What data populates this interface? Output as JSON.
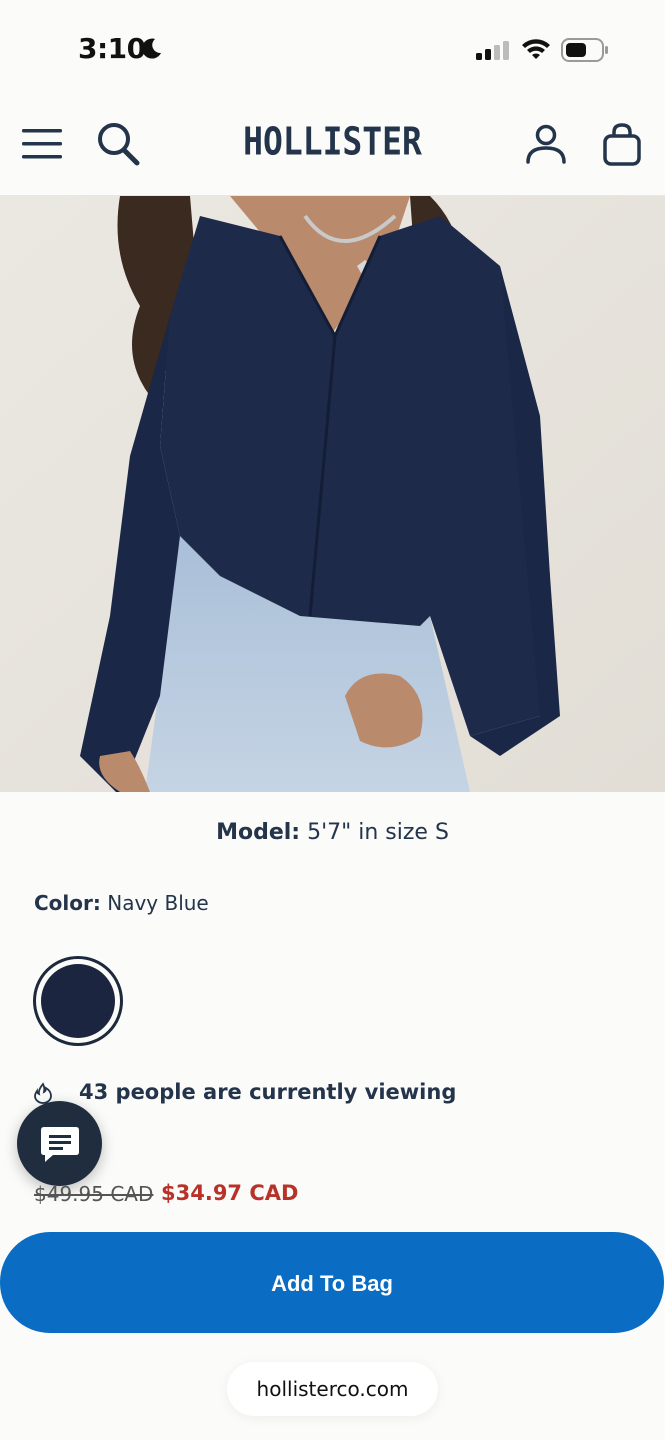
{
  "status_bar": {
    "time": "3:10",
    "icons": [
      "moon-icon",
      "signal-icon",
      "wifi-icon",
      "battery-icon"
    ]
  },
  "header": {
    "logo": "HOLLISTER",
    "icons": [
      "menu-icon",
      "search-icon",
      "account-icon",
      "bag-icon"
    ]
  },
  "product": {
    "model_label": "Model:",
    "model_value": "5'7\" in size S",
    "color_label": "Color:",
    "color_value": "Navy Blue",
    "swatch_color": "#1c2540",
    "viewing_text": "43 people are currently viewing",
    "price_original": "$49.95 CAD",
    "price_sale": "$34.97 CAD",
    "add_to_bag_label": "Add To Bag"
  },
  "colors": {
    "brand_text": "#23344b",
    "sale_red": "#b8322a",
    "button_blue": "#0a6cc3"
  },
  "browser": {
    "url": "hollisterco.com"
  }
}
